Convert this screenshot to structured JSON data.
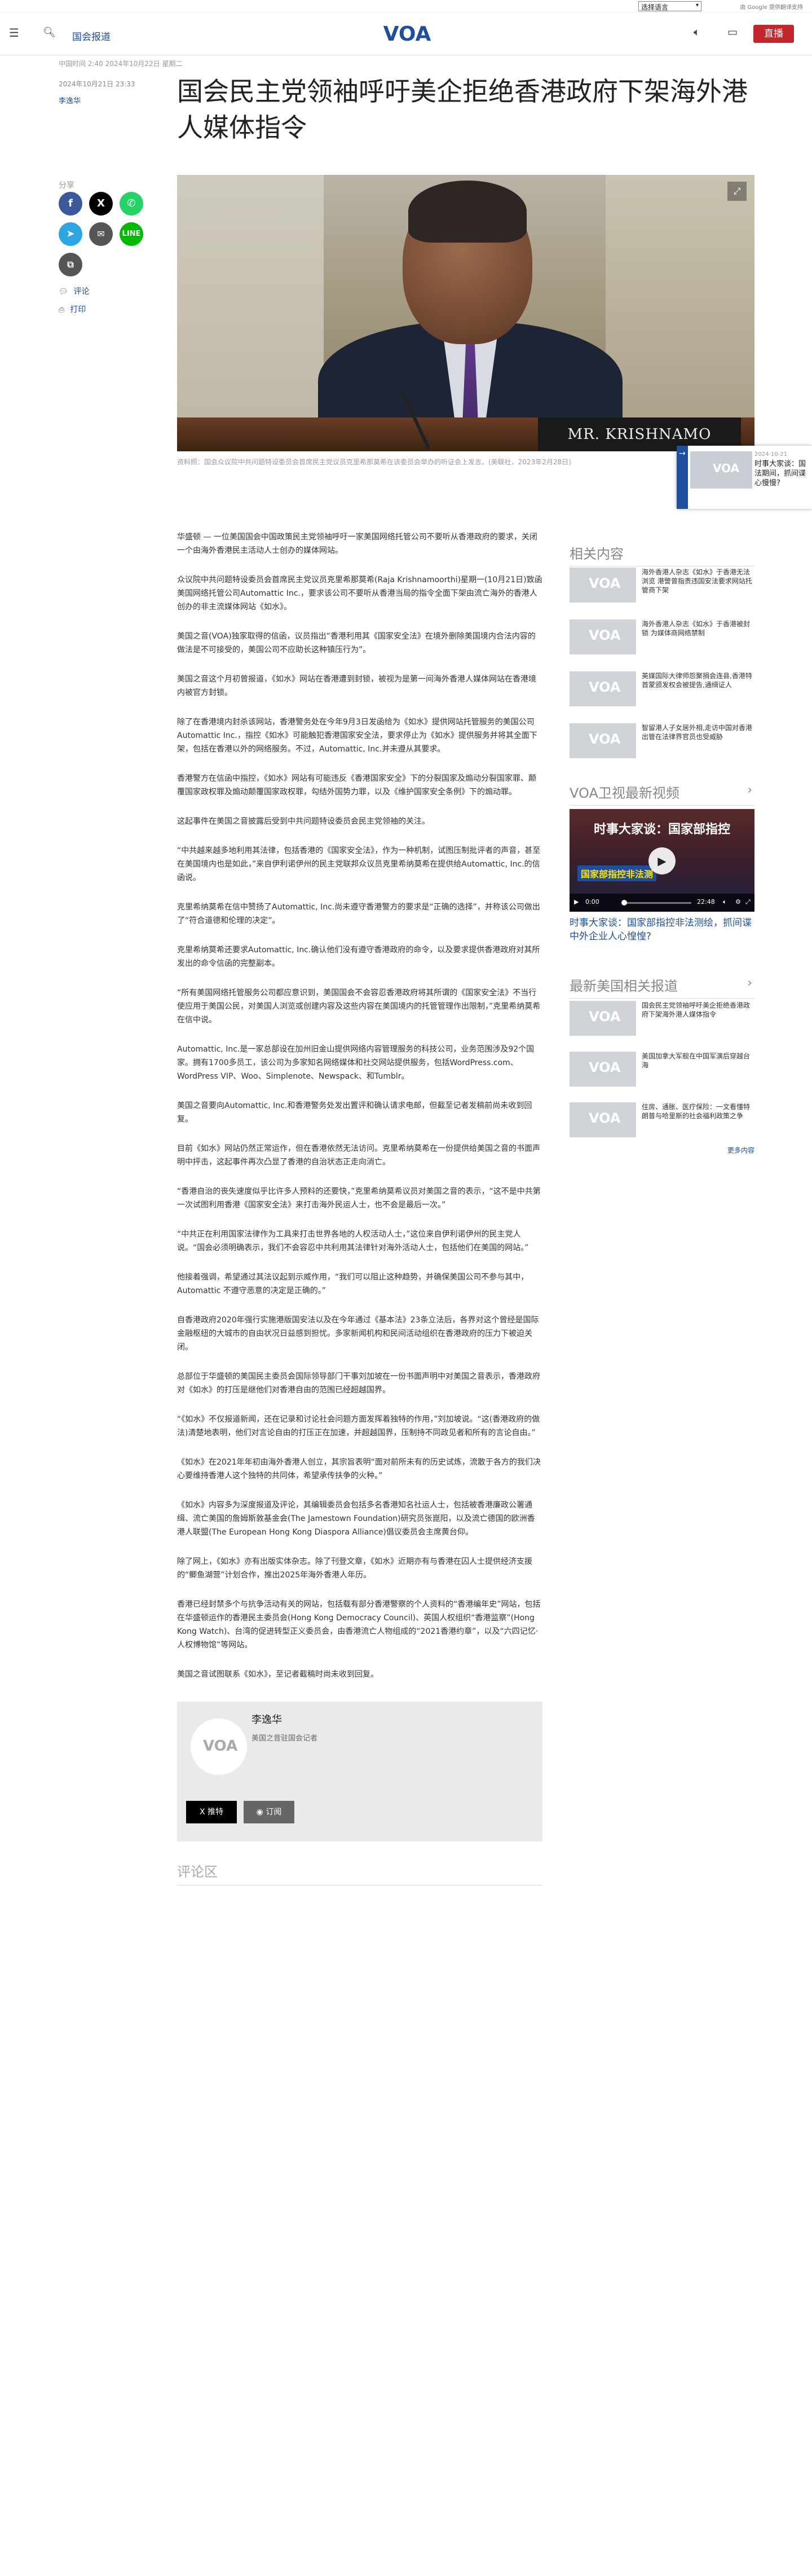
{
  "utility": {
    "language_select": "选择语言",
    "translate_note": "由 Google 提供翻译支持"
  },
  "header": {
    "section": "国会报道",
    "logo": "VOA",
    "live": "直播"
  },
  "meta": {
    "dateline": "中国时间 2:40 2024年10月22日 星期二",
    "published": "2024年10月21日 23:33",
    "author": "李逸华"
  },
  "headline": "国会民主党领袖呼吁美企拒绝香港政府下架海外港人媒体指令",
  "share": {
    "label": "分享",
    "comments": "评论",
    "print": "打印"
  },
  "hero": {
    "nameplate": "MR. KRISHNAMO",
    "caption": "资料照：国会众议院中共问题特设委员会首席民主党议员克里希那莫希在该委员会举办的听证会上发言。(美联社，2023年2月28日)"
  },
  "mini_player": {
    "date": "2024-10-21",
    "title": "时事大家谈：国法期间，抓间谍心慢慢?"
  },
  "article": {
    "paragraphs": [
      "华盛顿 — 一位美国国会中国政策民主党领袖呼吁一家美国网络托管公司不要听从香港政府的要求，关闭一个由海外香港民主活动人士创办的媒体网站。",
      "众议院中共问题特设委员会首席民主党议员克里希那莫希(Raja Krishnamoorthi)星期一(10月21日)致函美国网络托管公司Automattic Inc.，要求该公司不要听从香港当局的指令全面下架由流亡海外的香港人创办的非主流媒体网站《如水》。",
      "美国之音(VOA)独家取得的信函，议员指出“香港利用其《国家安全法》在境外删除美国境内合法内容的做法是不可接受的，美国公司不应助长这种镇压行为”。",
      "美国之音这个月初曾报道，《如水》网站在香港遭到封锁，被视为是第一间海外香港人媒体网站在香港境内被官方封锁。",
      "除了在香港境内封杀该网站，香港警务处在今年9月3日发函给为《如水》提供网站托管服务的美国公司Automattic Inc.，指控《如水》可能触犯香港国家安全法，要求停止为《如水》提供服务并将其全面下架，包括在香港以外的网络服务。不过，Automattic, Inc.并未遵从其要求。",
      "香港警方在信函中指控，《如水》网站有可能违反《香港国家安全》下的分裂国家及煽动分裂国家罪、颠覆国家政权罪及煽动颠覆国家政权罪，勾结外国势力罪，以及《维护国家安全条例》下的煽动罪。",
      "这起事件在美国之音披露后受到中共问题特设委员会民主党领袖的关注。",
      "“中共越来越多地利用其法律，包括香港的《国家安全法》，作为一种机制，试图压制批评者的声音，甚至在美国境内也是如此，”来自伊利诺伊州的民主党联邦众议员克里希纳莫希在提供给Automattic, Inc.的信函说。",
      "克里希纳莫希在信中赞扬了Automattic, Inc.尚未遵守香港警方的要求是“正确的选择”，并称该公司做出了“符合道德和伦理的决定”。",
      "克里希纳莫希还要求Automattic, Inc.确认他们没有遵守香港政府的命令，以及要求提供香港政府对其所发出的命令信函的完整副本。",
      "“所有美国网络托管服务公司都应意识到，美国国会不会容忍香港政府将其所谓的《国家安全法》不当行使应用于美国公民，对美国人浏览或创建内容及这些内容在美国境内的托管管理作出限制，”克里希纳莫希在信中说。",
      "Automattic, Inc.是一家总部设在加州旧金山提供网络内容管理服务的科技公司，业务范围涉及92个国家。拥有1700多员工，该公司为多家知名网络媒体和社交网站提供服务，包括WordPress.com、WordPress VIP、Woo、Simplenote、Newspack、和Tumblr。",
      "美国之音要向Automattic, Inc.和香港警务处发出置评和确认请求电邮，但截至记者发稿前尚未收到回复。",
      "目前《如水》网站仍然正常运作，但在香港依然无法访问。克里希纳莫希在一份提供给美国之音的书面声明中抨击，这起事件再次凸显了香港的自治状态正走向消亡。",
      "“香港自治的丧失速度似乎比许多人预料的还要快，”克里希纳莫希议员对美国之音的表示，“这不是中共第一次试图利用香港《国家安全法》来打击海外民运人士，也不会是最后一次。”",
      "“中共正在利用国家法律作为工具来打击世界各地的人权活动人士，”这位来自伊利诺伊州的民主党人说。“国会必须明确表示，我们不会容忍中共利用其法律针对海外活动人士，包括他们在美国的网站。”",
      "他接着强调，希望通过其法议起到示威作用，“我们可以阻止这种趋势，并确保美国公司不参与其中，Automattic 不遵守恶意的决定是正确的。”",
      "自香港政府2020年强行实施港版国安法以及在今年通过《基本法》23条立法后，各界对这个曾经是国际金融枢纽的大城市的自由状况日益感到担忧。多家新闻机构和民间活动组织在香港政府的压力下被迫关闭。",
      "总部位于华盛顿的美国民主委员会国际领导部门干事刘加坡在一份书面声明中对美国之音表示，香港政府对《如水》的打压是继他们对香港自由的范围已经超越国界。",
      "“《如水》不仅报道新闻，还在记录和讨论社会问题方面发挥着独特的作用，”刘加坡说。“这(香港政府的做法)清楚地表明，他们对言论自由的打压正在加速，并超越国界，压制持不同政见者和所有的言论自由。”",
      "《如水》在2021年年初由海外香港人创立，其宗旨表明“面对前所未有的历史试炼，流散于各方的我们决心要维持香港人这个独特的共同体，希望承传扶争的火种。”",
      "《如水》内容多为深度报道及评论，其编辑委员会包括多名香港知名社运人士，包括被香港廉政公署通缉、流亡美国的詹姆斯敦基金会(The Jamestown Foundation)研究员张崑阳，以及流亡德国的欧洲香港人联盟(The European Hong Kong Diaspora Alliance)倡议委员会主席黄台仰。",
      "除了网上，《如水》亦有出版实体杂志。除了刊登文章，《如水》近期亦有与香港在囚人士提供经济支援的“鲫鱼湖营”计划合作，推出2025年海外香港人年历。",
      "香港已经封禁多个与抗争活动有关的网站，包括载有部分香港警察的个人资料的“香港编年史”网站，包括在华盛顿运作的香港民主委员会(Hong Kong Democracy Council)、英国人权组织“香港监察”(Hong Kong Watch)、台湾的促进转型正义委员会，由香港流亡人物组成的“2021香港约章”，以及“六四记忆·人权博物馆”等网站。",
      "美国之音试图联系《如水》，至记者截稿时尚未收到回复。"
    ]
  },
  "author_box": {
    "name": "李逸华",
    "role": "美国之音驻国会记者",
    "follow": "推特",
    "subscribe": "订阅"
  },
  "comments_heading": "评论区",
  "sidebar": {
    "related_heading": "相关内容",
    "related": [
      "海外香港人杂志《如水》于香港无法浏览 港警曾指责违国安法要求网站托管商下架",
      "海外香港人杂志《如水》于香港被封锁 为媒体商网络禁制",
      "英媒国际大律师怨聚捐会连县,香港特首蒙颁发权会被提告,通缉证人",
      "智留港人子女居外相,走访中国对香港出管在法律界官员也受威胁"
    ],
    "video_heading": "VOA卫视最新视频",
    "video_banner": "时事大家谈：国家部指控",
    "video_banner2": "国家部指控非法测",
    "video_time_current": "0:00",
    "video_time_total": "22:48",
    "video_title": "时事大家谈：国家部指控非法测绘，抓间谍中外企业人心惶惶?",
    "latest_heading": "最新美国相关报道",
    "latest": [
      "国会民主党领袖呼吁美企拒绝香港政府下架海外港人媒体指令",
      "美国加拿大军舰在中国军演后穿越台海",
      "住房、通胀、医疗保险：一文看懂特朗普与哈里斯的社会福利政策之争"
    ],
    "latest_more": "更多内容"
  },
  "colors": {
    "brand_blue": "#1f4e9c",
    "live_red": "#c1272d",
    "facebook": "#3b5998",
    "whatsapp": "#25d366",
    "telegram": "#2ca5e0",
    "line": "#00b900"
  }
}
